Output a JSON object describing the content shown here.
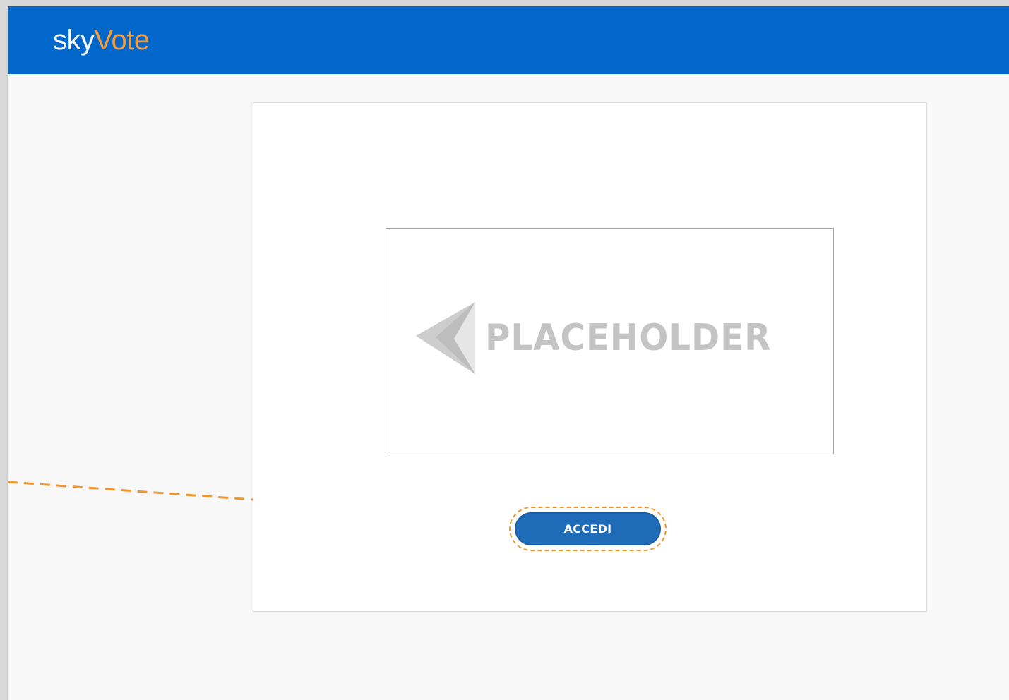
{
  "header": {
    "logo_part1": "sky",
    "logo_part2": "Vote",
    "background_color": "#0267cb",
    "accent_color": "#f39c3b"
  },
  "card": {
    "image_placeholder_text": "PLACEHOLDER",
    "image_icon": "placeholder-logo-icon",
    "login_button_label": "ACCEDI",
    "button_color": "#1e6bb8"
  },
  "annotation": {
    "color": "#f1962d",
    "style": "dashed callout"
  }
}
